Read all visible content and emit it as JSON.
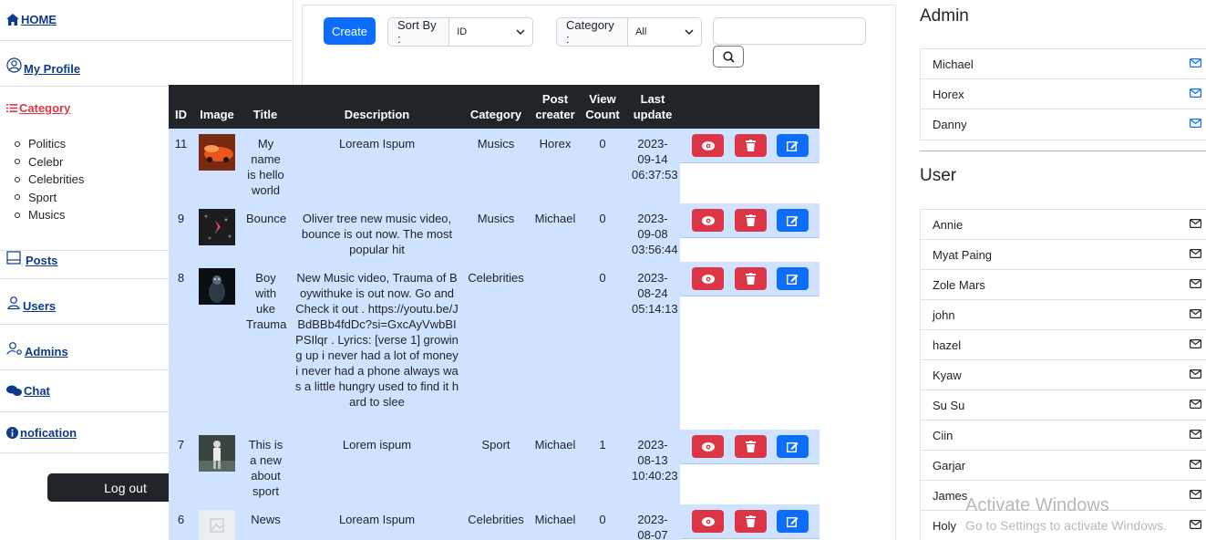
{
  "sidebar": {
    "home": "HOME",
    "profile": "My Profile",
    "category": "Category",
    "categories": [
      "Politics",
      "Celebr",
      "Celebrities",
      "Sport",
      "Musics"
    ],
    "posts": "Posts",
    "users": "Users",
    "admins": "Admins",
    "chat": "Chat",
    "notification": "nofication",
    "logout": "Log out"
  },
  "toolbar": {
    "create": "Create",
    "sort_label": "Sort By :",
    "sort_value": "ID",
    "category_label": "Category :",
    "category_value": "All",
    "search_value": ""
  },
  "table": {
    "headers": {
      "id": "ID",
      "image": "Image",
      "title": "Title",
      "description": "Description",
      "category": "Category",
      "creator": "Post creater",
      "views": "View Count",
      "updated": "Last update"
    },
    "rows": [
      {
        "id": "11",
        "title": "My name is hello world",
        "description": "Loream Ispum",
        "category": "Musics",
        "creator": "Horex",
        "views": "0",
        "updated": "2023-09-14 06:37:53",
        "thumb": "orange"
      },
      {
        "id": "9",
        "title": "Bounce",
        "description": "Oliver tree new music video, bounce is out now. The most popular hit",
        "category": "Musics",
        "creator": "Michael",
        "views": "0",
        "updated": "2023-09-08 03:56:44",
        "thumb": "pink"
      },
      {
        "id": "8",
        "title": "Boy with uke Trauma",
        "description": "New Music video, Trauma of Boywithuke is out now. Go and Check it out . https://youtu.be/JBdBBb4fdDc?si=GxcAyVwbBIPSIlqr . Lyrics: [verse 1] growing up i never had a lot of money i never had a phone always was a little hungry used to find it hard to slee",
        "category": "Celebrities",
        "creator": "",
        "views": "0",
        "updated": "2023-08-24 05:14:13",
        "thumb": "dark"
      },
      {
        "id": "7",
        "title": "This is a new about sport",
        "description": "Lorem ispum",
        "category": "Sport",
        "creator": "Michael",
        "views": "1",
        "updated": "2023-08-13 10:40:23",
        "thumb": "sport"
      },
      {
        "id": "6",
        "title": "News",
        "description": "Loream Ispum",
        "category": "Celebrities",
        "creator": "Michael",
        "views": "0",
        "updated": "2023-08-07",
        "thumb": "placeholder"
      }
    ]
  },
  "right": {
    "admin_title": "Admin",
    "admins": [
      "Michael",
      "Horex",
      "Danny"
    ],
    "user_title": "User",
    "users": [
      "Annie",
      "Myat Paing",
      "Zole Mars",
      "john",
      "hazel",
      "Kyaw",
      "Su Su",
      "Ciin",
      "Garjar",
      "James",
      "Holy"
    ]
  },
  "watermark": {
    "line1": "Activate Windows",
    "line2": "Go to Settings to activate Windows."
  },
  "colors": {
    "primary": "#0d6efd",
    "danger": "#dc3545",
    "row_bg": "#cfe2ff",
    "header_bg": "#212529"
  }
}
